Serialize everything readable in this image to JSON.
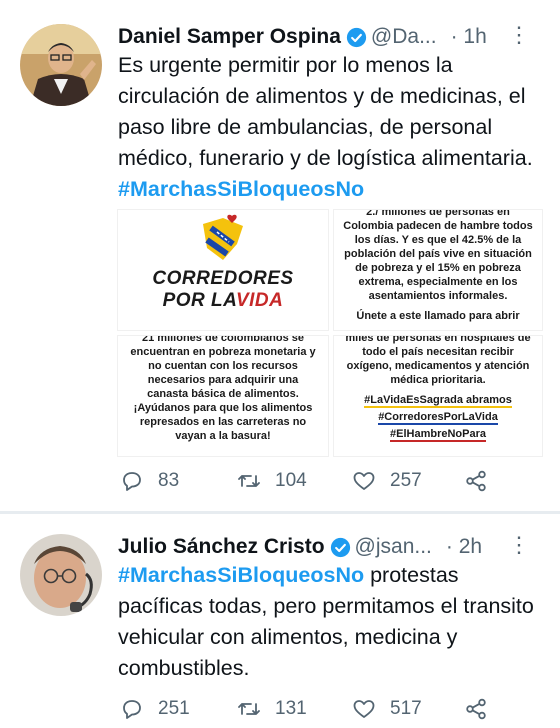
{
  "tweets": [
    {
      "name": "Daniel Samper Ospina",
      "handle": "@Da...",
      "time": "· 1h",
      "text": "Es urgente permitir por lo menos la circulación de alimentos y de medicinas, el paso libre de ambulancias, de personal médico, funerario y de logística alimentaria.",
      "hashtag": "#MarchasSiBloqueosNo",
      "media": {
        "img1": {
          "title_line1": "CORREDORES",
          "title_line2a": "POR LA",
          "title_line2b": "VIDA"
        },
        "img2": {
          "top_cut": "2./ millones de personas en",
          "lines": [
            "Colombia padecen de hambre todos",
            "los días. Y es que el 42.5% de la",
            "población del país vive en situación",
            "de pobreza y el 15% en pobreza",
            "extrema, especialmente en los",
            "asentamientos informales."
          ],
          "footer": "Únete a este llamado para abrir"
        },
        "img3": {
          "top_cut": "21 millones de colombianos se",
          "lines": [
            "encuentran en pobreza monetaria y",
            "no cuentan con los recursos",
            "necesarios para adquirir una",
            "canasta básica de alimentos.",
            "¡Ayúdanos para que los alimentos",
            "represados en las carreteras no",
            "vayan a la basura!"
          ]
        },
        "img4": {
          "top_cut": "miles de personas en hospitales de",
          "lines": [
            "todo el país necesitan recibir",
            "oxígeno, medicamentos y atención",
            "médica prioritaria."
          ],
          "tags": [
            "#LaVidaEsSagrada abramos",
            "#CorredoresPorLaVida",
            "#ElHambreNoPara"
          ]
        }
      },
      "stats": {
        "replies": "83",
        "retweets": "104",
        "likes": "257"
      }
    },
    {
      "name": "Julio Sánchez Cristo",
      "handle": "@jsan...",
      "time": "· 2h",
      "hashtag": "#MarchasSiBloqueosNo",
      "text": " protestas pacíficas todas, pero permitamos el transito vehicular con alimentos, medicina y combustibles.",
      "stats": {
        "replies": "251",
        "retweets": "131",
        "likes": "517"
      }
    }
  ],
  "colors": {
    "accent": "#1d9bf0",
    "secondary_text": "#536471",
    "divider": "#e7ecf0"
  },
  "icons": [
    "verified-badge-icon",
    "more-icon",
    "reply-icon",
    "retweet-icon",
    "like-icon",
    "share-icon"
  ]
}
